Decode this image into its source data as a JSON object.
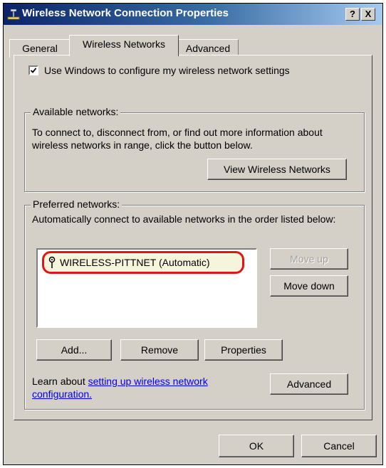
{
  "window": {
    "title": "Wireless Network Connection Properties",
    "help_label": "?",
    "close_label": "X"
  },
  "tabs": [
    {
      "label": "General"
    },
    {
      "label": "Wireless Networks"
    },
    {
      "label": "Advanced"
    }
  ],
  "wireless_tab": {
    "use_windows_label": "Use Windows to configure my wireless network settings",
    "use_windows_checked": true,
    "available": {
      "group_label": "Available networks:",
      "description": "To connect to, disconnect from, or find out more information about wireless networks in range, click the button below.",
      "view_button": "View Wireless Networks"
    },
    "preferred": {
      "group_label": "Preferred networks:",
      "description": "Automatically connect to available networks in the order listed below:",
      "networks": [
        {
          "name": "WIRELESS-PITTNET (Automatic)"
        }
      ],
      "move_up": "Move up",
      "move_down": "Move down",
      "add": "Add...",
      "remove": "Remove",
      "properties": "Properties"
    },
    "learn_prefix": "Learn about ",
    "learn_link_line1": "setting up wireless network",
    "learn_link_line2": "configuration.",
    "advanced_button": "Advanced"
  },
  "footer": {
    "ok": "OK",
    "cancel": "Cancel"
  },
  "colors": {
    "highlight_ring": "#e31414",
    "title_start": "#0a246a"
  }
}
